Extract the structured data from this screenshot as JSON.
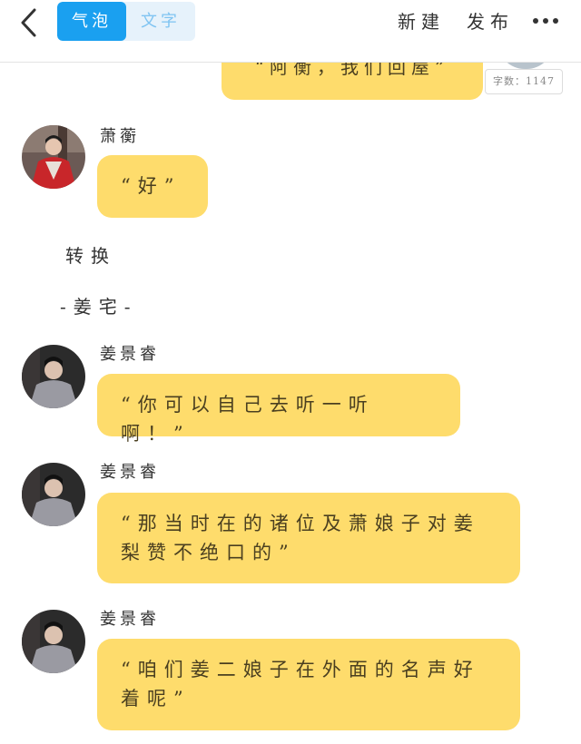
{
  "header": {
    "tabs": [
      {
        "label": "气泡",
        "active": true
      },
      {
        "label": "文字",
        "active": false
      }
    ],
    "new_label": "新建",
    "publish_label": "发布",
    "colors": {
      "accent": "#1aa0f0",
      "bubble": "#fedc6c"
    }
  },
  "top_message": {
    "text": "“阿衡，我们回屋”",
    "word_count": "字数：1147"
  },
  "messages": [
    {
      "name": "萧蘅",
      "text": "“好”"
    },
    {
      "name": "姜景睿",
      "text": "“你可以自己去听一听啊！”"
    },
    {
      "name": "姜景睿",
      "text": "“那当时在的诸位及萧娘子对姜梨赞不绝口的”"
    },
    {
      "name": "姜景睿",
      "text": "“咱们姜二娘子在外面的名声好着呢”"
    }
  ],
  "narration": [
    {
      "text": "转换"
    },
    {
      "text": "-姜宅-"
    }
  ]
}
